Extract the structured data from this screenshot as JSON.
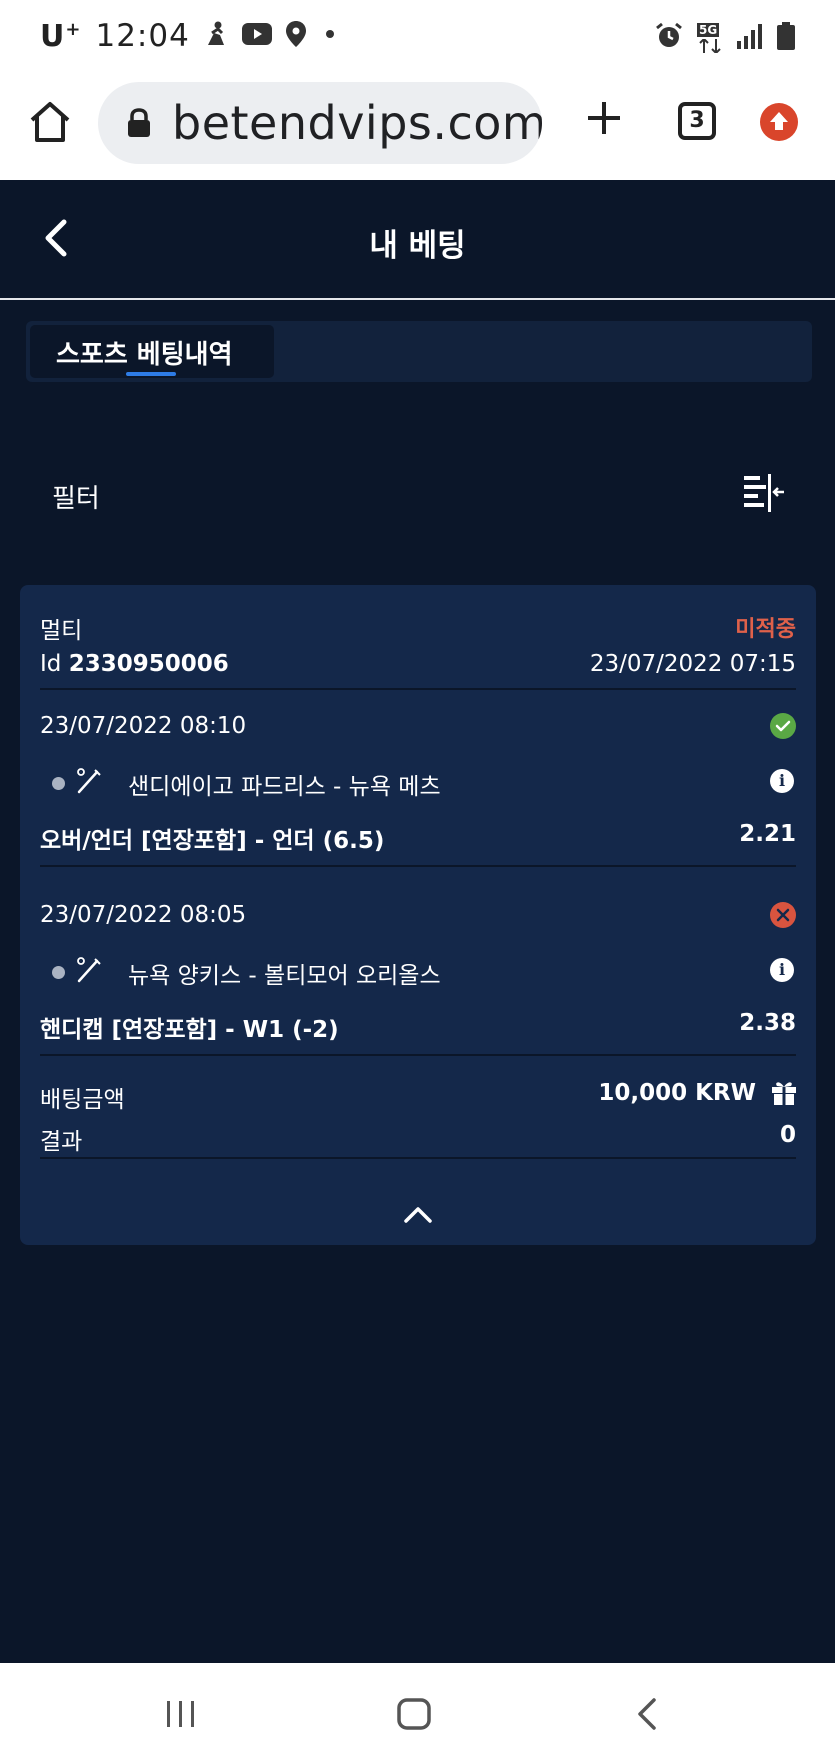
{
  "status_bar": {
    "carrier": "U",
    "carrier_sup": "+",
    "time": "12:04",
    "network": "5G",
    "icons": [
      "figure-icon",
      "youtube-icon",
      "location-icon",
      "dot-icon",
      "alarm-icon",
      "signal-icon",
      "battery-icon"
    ]
  },
  "browser": {
    "url": "betendvips.com/",
    "tab_count": "3"
  },
  "page": {
    "title": "내 베팅"
  },
  "tabs": [
    {
      "label": "스포츠 베팅내역",
      "active": true
    }
  ],
  "filter": {
    "label": "필터"
  },
  "bet": {
    "type": "멀티",
    "status": "미적중",
    "id_prefix": "Id",
    "id": "2330950006",
    "placed_at": "23/07/2022 07:15",
    "selections": [
      {
        "datetime": "23/07/2022 08:10",
        "result": "win",
        "match": "샌디에이고 파드리스 - 뉴욕 메츠",
        "market": "오버/언더 [연장포함] - 언더 (6.5)",
        "odds": "2.21"
      },
      {
        "datetime": "23/07/2022 08:05",
        "result": "loss",
        "match": "뉴욕 양키스 - 볼티모어 오리올스",
        "market": "핸디캡 [연장포함] - W1 (-2)",
        "odds": "2.38"
      }
    ],
    "stake_label": "배팅금액",
    "stake_value": "10,000 KRW",
    "result_label": "결과",
    "result_value": "0"
  },
  "colors": {
    "background": "#0b1629",
    "card": "#14284a",
    "accent": "#2e7ce6",
    "win": "#5aa845",
    "loss": "#d9543f",
    "pending_text": "#e0614a"
  }
}
